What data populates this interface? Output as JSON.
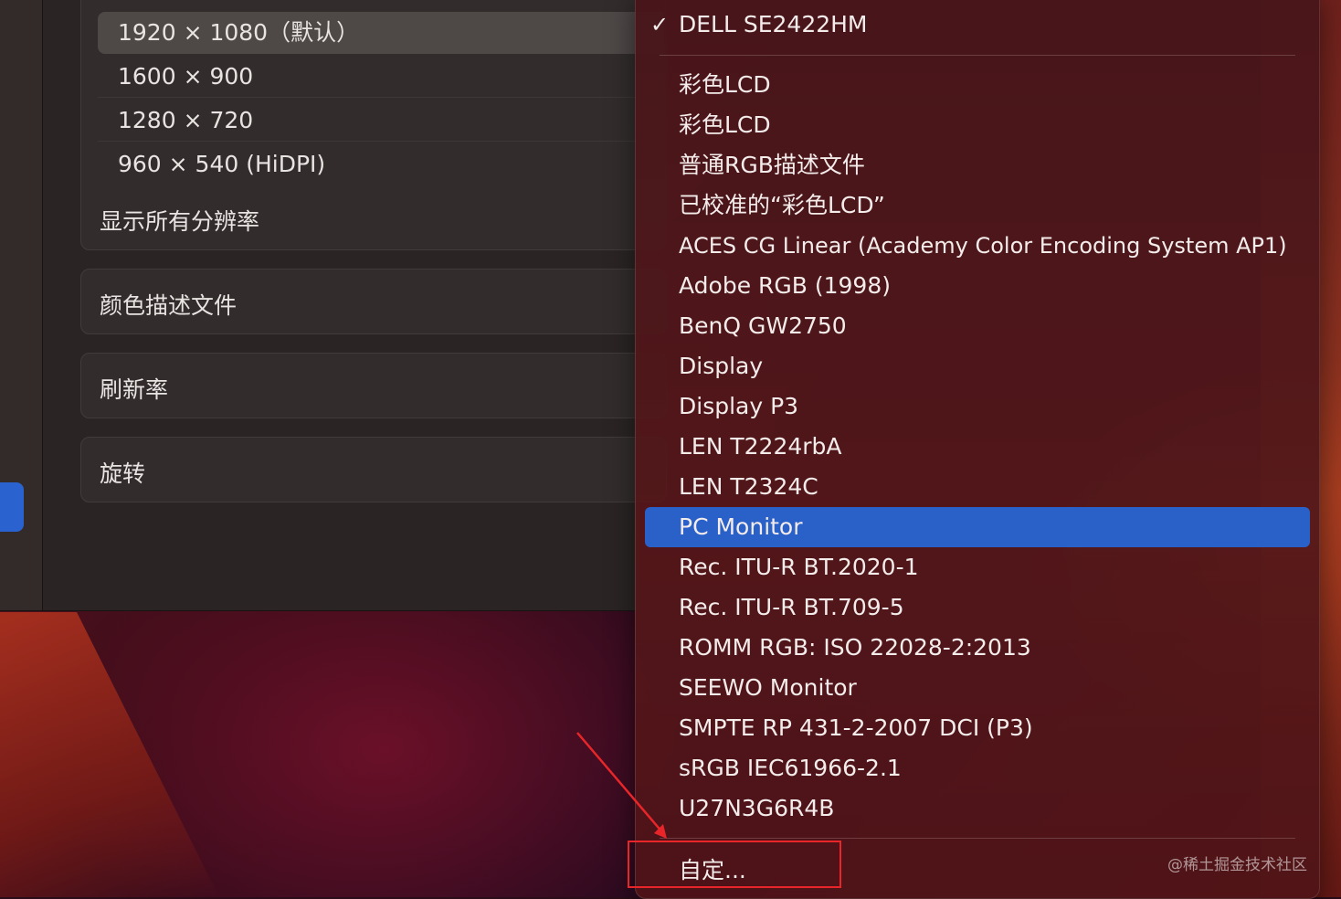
{
  "resolutions": {
    "items": [
      {
        "label": "1920 × 1080（默认）",
        "selected": true
      },
      {
        "label": "1600 × 900",
        "selected": false
      },
      {
        "label": "1280 × 720",
        "selected": false
      },
      {
        "label": "960 × 540 (HiDPI)",
        "selected": false
      }
    ],
    "show_all": "显示所有分辨率"
  },
  "settings": {
    "color_profile_label": "颜色描述文件",
    "refresh_rate_label": "刷新率",
    "rotation_label": "旋转"
  },
  "menu": {
    "checked_item": "DELL SE2422HM",
    "check_glyph": "✓",
    "items": [
      "彩色LCD",
      "彩色LCD",
      "普通RGB描述文件",
      "已校准的“彩色LCD”",
      "ACES CG Linear (Academy Color Encoding System AP1)",
      "Adobe RGB (1998)",
      "BenQ GW2750",
      "Display",
      "Display P3",
      "LEN T2224rbA",
      "LEN T2324C",
      "PC Monitor",
      "Rec. ITU-R BT.2020-1",
      "Rec. ITU-R BT.709-5",
      "ROMM RGB: ISO 22028-2:2013",
      "SEEWO Monitor",
      "SMPTE RP 431-2-2007 DCI (P3)",
      "sRGB IEC61966-2.1",
      "U27N3G6R4B"
    ],
    "highlighted_item": "PC Monitor",
    "custom": "自定..."
  },
  "annotation": {
    "box_color": "#e8262a"
  },
  "watermark": "@稀土掘金技术社区",
  "colors": {
    "accent": "#2a61c8",
    "sidebar_selected": "#2a63cf"
  }
}
